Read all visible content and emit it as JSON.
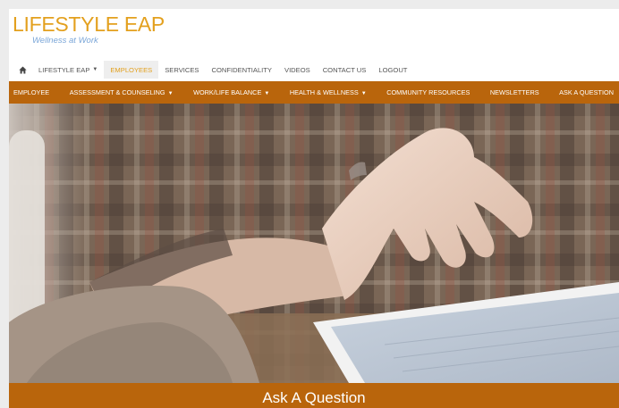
{
  "logo": {
    "title": "LIFESTYLE EAP",
    "tagline": "Wellness at Work"
  },
  "top_nav": {
    "home_icon": "home-icon",
    "items": [
      {
        "label": "LIFESTYLE EAP",
        "has_dropdown": true
      },
      {
        "label": "EMPLOYEES",
        "active": true
      },
      {
        "label": "SERVICES"
      },
      {
        "label": "CONFIDENTIALITY"
      },
      {
        "label": "VIDEOS"
      },
      {
        "label": "CONTACT US"
      },
      {
        "label": "LOGOUT"
      }
    ]
  },
  "secondary_nav": {
    "items": [
      {
        "label": "EMPLOYEE"
      },
      {
        "label": "ASSESSMENT & COUNSELING",
        "has_dropdown": true
      },
      {
        "label": "WORK/LIFE BALANCE",
        "has_dropdown": true
      },
      {
        "label": "HEALTH & WELLNESS",
        "has_dropdown": true
      },
      {
        "label": "COMMUNITY RESOURCES"
      },
      {
        "label": "NEWSLETTERS"
      },
      {
        "label": "ASK A QUESTION"
      }
    ]
  },
  "banner": {
    "title": "Ask A Question"
  },
  "colors": {
    "brand_orange": "#b9650c",
    "logo_gold": "#e3a01e",
    "tagline_blue": "#7aa6d8",
    "active_text": "#e3a01e"
  }
}
